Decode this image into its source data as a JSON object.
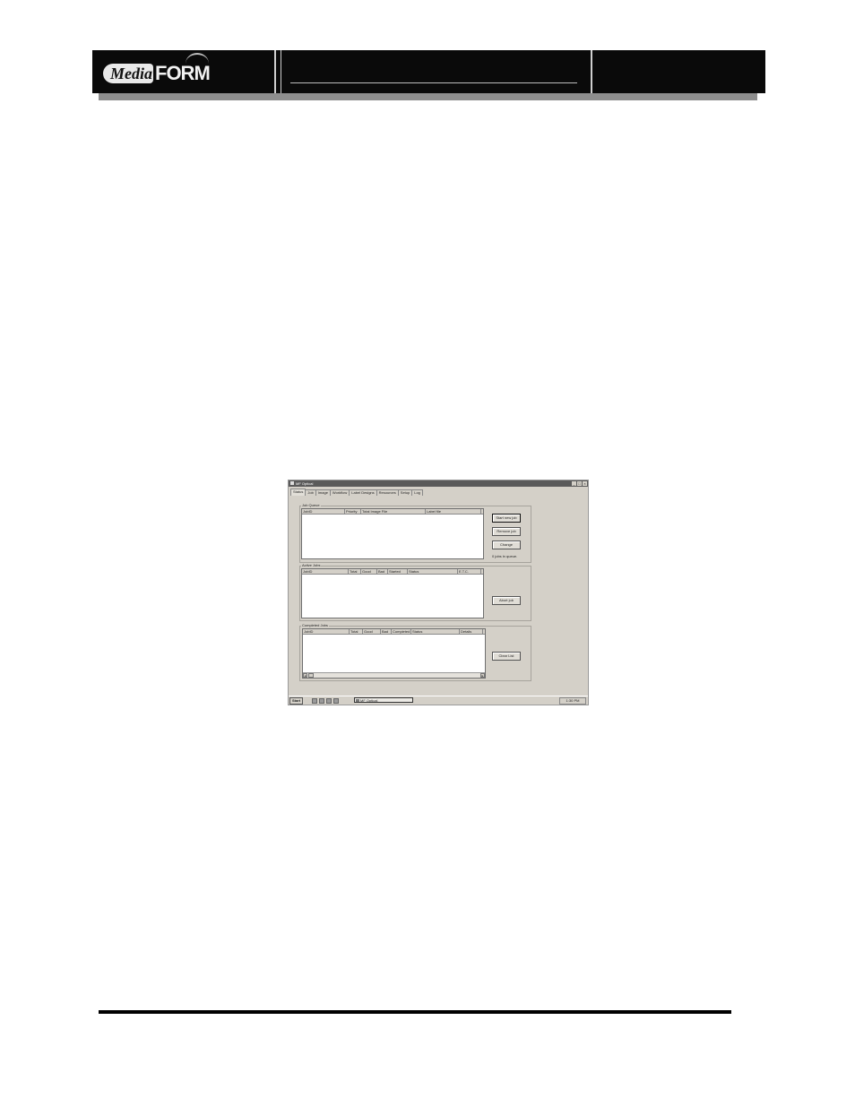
{
  "header": {
    "logo_media": "Media",
    "logo_form": "FORM"
  },
  "app": {
    "title": "MF Optical",
    "window_buttons": {
      "minimize": "_",
      "maximize": "□",
      "close": "×"
    },
    "tabs": [
      {
        "label": "Status",
        "active": true
      },
      {
        "label": "Job",
        "active": false
      },
      {
        "label": "Image",
        "active": false
      },
      {
        "label": "Workflow",
        "active": false
      },
      {
        "label": "Label Designs",
        "active": false
      },
      {
        "label": "Resources",
        "active": false
      },
      {
        "label": "Setup",
        "active": false
      },
      {
        "label": "Log",
        "active": false
      }
    ],
    "job_queue": {
      "label": "Job Queue",
      "columns": [
        "JobID",
        "Priority",
        "Total Image File",
        "Label file"
      ],
      "buttons": {
        "start": "Start new job",
        "remove": "Remove job",
        "change": "Change"
      },
      "status": "0 jobs in queue."
    },
    "active_jobs": {
      "label": "Active Jobs",
      "columns": [
        "JobID",
        "Total",
        "Good",
        "Bad",
        "Started",
        "Status",
        "E.T.C."
      ],
      "buttons": {
        "abort": "Abort job"
      }
    },
    "completed_jobs": {
      "label": "Completed Jobs",
      "columns": [
        "JobID",
        "Total",
        "Good",
        "Bad",
        "Completed",
        "Status",
        "Details"
      ],
      "buttons": {
        "clear": "Clear List"
      },
      "scroll_left": "◄",
      "scroll_right": "►"
    },
    "taskbar": {
      "start_label": "Start",
      "task_label": "MF Optical",
      "clock": "1:30 PM"
    }
  }
}
